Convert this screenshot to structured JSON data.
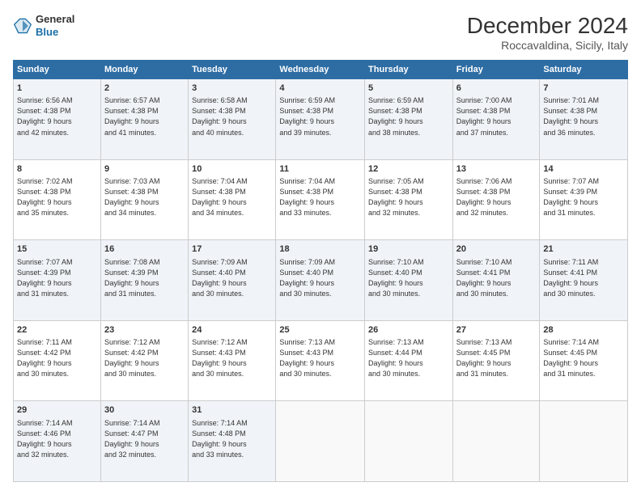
{
  "header": {
    "logo_general": "General",
    "logo_blue": "Blue",
    "month_year": "December 2024",
    "location": "Roccavaldina, Sicily, Italy"
  },
  "calendar": {
    "days_of_week": [
      "Sunday",
      "Monday",
      "Tuesday",
      "Wednesday",
      "Thursday",
      "Friday",
      "Saturday"
    ],
    "weeks": [
      [
        {
          "day": "1",
          "info": "Sunrise: 6:56 AM\nSunset: 4:38 PM\nDaylight: 9 hours\nand 42 minutes."
        },
        {
          "day": "2",
          "info": "Sunrise: 6:57 AM\nSunset: 4:38 PM\nDaylight: 9 hours\nand 41 minutes."
        },
        {
          "day": "3",
          "info": "Sunrise: 6:58 AM\nSunset: 4:38 PM\nDaylight: 9 hours\nand 40 minutes."
        },
        {
          "day": "4",
          "info": "Sunrise: 6:59 AM\nSunset: 4:38 PM\nDaylight: 9 hours\nand 39 minutes."
        },
        {
          "day": "5",
          "info": "Sunrise: 6:59 AM\nSunset: 4:38 PM\nDaylight: 9 hours\nand 38 minutes."
        },
        {
          "day": "6",
          "info": "Sunrise: 7:00 AM\nSunset: 4:38 PM\nDaylight: 9 hours\nand 37 minutes."
        },
        {
          "day": "7",
          "info": "Sunrise: 7:01 AM\nSunset: 4:38 PM\nDaylight: 9 hours\nand 36 minutes."
        }
      ],
      [
        {
          "day": "8",
          "info": "Sunrise: 7:02 AM\nSunset: 4:38 PM\nDaylight: 9 hours\nand 35 minutes."
        },
        {
          "day": "9",
          "info": "Sunrise: 7:03 AM\nSunset: 4:38 PM\nDaylight: 9 hours\nand 34 minutes."
        },
        {
          "day": "10",
          "info": "Sunrise: 7:04 AM\nSunset: 4:38 PM\nDaylight: 9 hours\nand 34 minutes."
        },
        {
          "day": "11",
          "info": "Sunrise: 7:04 AM\nSunset: 4:38 PM\nDaylight: 9 hours\nand 33 minutes."
        },
        {
          "day": "12",
          "info": "Sunrise: 7:05 AM\nSunset: 4:38 PM\nDaylight: 9 hours\nand 32 minutes."
        },
        {
          "day": "13",
          "info": "Sunrise: 7:06 AM\nSunset: 4:38 PM\nDaylight: 9 hours\nand 32 minutes."
        },
        {
          "day": "14",
          "info": "Sunrise: 7:07 AM\nSunset: 4:39 PM\nDaylight: 9 hours\nand 31 minutes."
        }
      ],
      [
        {
          "day": "15",
          "info": "Sunrise: 7:07 AM\nSunset: 4:39 PM\nDaylight: 9 hours\nand 31 minutes."
        },
        {
          "day": "16",
          "info": "Sunrise: 7:08 AM\nSunset: 4:39 PM\nDaylight: 9 hours\nand 31 minutes."
        },
        {
          "day": "17",
          "info": "Sunrise: 7:09 AM\nSunset: 4:40 PM\nDaylight: 9 hours\nand 30 minutes."
        },
        {
          "day": "18",
          "info": "Sunrise: 7:09 AM\nSunset: 4:40 PM\nDaylight: 9 hours\nand 30 minutes."
        },
        {
          "day": "19",
          "info": "Sunrise: 7:10 AM\nSunset: 4:40 PM\nDaylight: 9 hours\nand 30 minutes."
        },
        {
          "day": "20",
          "info": "Sunrise: 7:10 AM\nSunset: 4:41 PM\nDaylight: 9 hours\nand 30 minutes."
        },
        {
          "day": "21",
          "info": "Sunrise: 7:11 AM\nSunset: 4:41 PM\nDaylight: 9 hours\nand 30 minutes."
        }
      ],
      [
        {
          "day": "22",
          "info": "Sunrise: 7:11 AM\nSunset: 4:42 PM\nDaylight: 9 hours\nand 30 minutes."
        },
        {
          "day": "23",
          "info": "Sunrise: 7:12 AM\nSunset: 4:42 PM\nDaylight: 9 hours\nand 30 minutes."
        },
        {
          "day": "24",
          "info": "Sunrise: 7:12 AM\nSunset: 4:43 PM\nDaylight: 9 hours\nand 30 minutes."
        },
        {
          "day": "25",
          "info": "Sunrise: 7:13 AM\nSunset: 4:43 PM\nDaylight: 9 hours\nand 30 minutes."
        },
        {
          "day": "26",
          "info": "Sunrise: 7:13 AM\nSunset: 4:44 PM\nDaylight: 9 hours\nand 30 minutes."
        },
        {
          "day": "27",
          "info": "Sunrise: 7:13 AM\nSunset: 4:45 PM\nDaylight: 9 hours\nand 31 minutes."
        },
        {
          "day": "28",
          "info": "Sunrise: 7:14 AM\nSunset: 4:45 PM\nDaylight: 9 hours\nand 31 minutes."
        }
      ],
      [
        {
          "day": "29",
          "info": "Sunrise: 7:14 AM\nSunset: 4:46 PM\nDaylight: 9 hours\nand 32 minutes."
        },
        {
          "day": "30",
          "info": "Sunrise: 7:14 AM\nSunset: 4:47 PM\nDaylight: 9 hours\nand 32 minutes."
        },
        {
          "day": "31",
          "info": "Sunrise: 7:14 AM\nSunset: 4:48 PM\nDaylight: 9 hours\nand 33 minutes."
        },
        {
          "day": "",
          "info": ""
        },
        {
          "day": "",
          "info": ""
        },
        {
          "day": "",
          "info": ""
        },
        {
          "day": "",
          "info": ""
        }
      ]
    ]
  }
}
